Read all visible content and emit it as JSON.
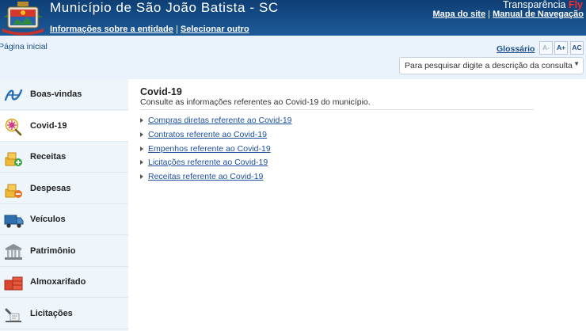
{
  "header": {
    "title": "Município de São João Batista - SC",
    "info_link": "Informações sobre a entidade",
    "separator": "|",
    "select_link": "Selecionar outro",
    "brand_name": "Transparência",
    "brand_fly": "Fly",
    "sitemap_link": "Mapa do site",
    "manual_link": "Manual de Navegação"
  },
  "topbar": {
    "breadcrumb": "Página inicial",
    "glossary": "Glossário",
    "font_decrease": "A-",
    "font_increase": "A+",
    "contrast": "AC",
    "search_placeholder": "Para pesquisar digite a descrição da consulta"
  },
  "sidebar": {
    "items": [
      {
        "label": "Boas-vindas",
        "icon": "welcome-icon"
      },
      {
        "label": "Covid-19",
        "icon": "covid-icon",
        "active": true
      },
      {
        "label": "Receitas",
        "icon": "revenue-icon"
      },
      {
        "label": "Despesas",
        "icon": "expense-icon"
      },
      {
        "label": "Veículos",
        "icon": "truck-icon"
      },
      {
        "label": "Patrimônio",
        "icon": "building-icon"
      },
      {
        "label": "Almoxarifado",
        "icon": "warehouse-icon"
      },
      {
        "label": "Licitações",
        "icon": "bidding-icon"
      }
    ]
  },
  "content": {
    "title": "Covid-19",
    "subtitle": "Consulte as informações referentes ao Covid-19 do município.",
    "links": [
      "Compras diretas referente ao Covid-19",
      "Contratos referente ao Covid-19",
      "Empenhos referente ao Covid-19",
      "Licitações referente ao Covid-19",
      "Receitas referente ao Covid-19"
    ]
  },
  "colors": {
    "header_bg": "#1a4f8a",
    "sidebar_bg": "#eef5fb",
    "link": "#1d4f9a",
    "brand_accent": "#ff2a2a"
  }
}
